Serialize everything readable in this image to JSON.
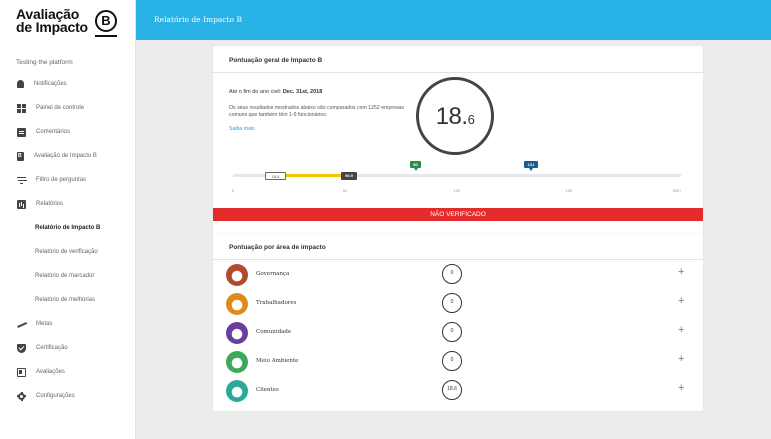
{
  "brand": {
    "line1": "Avaliação",
    "line2": "de Impacto",
    "b_mark": "B"
  },
  "sidebar": {
    "company": "Testing the platform",
    "items": [
      {
        "label": "Notificações",
        "icon": "bell-icon"
      },
      {
        "label": "Painel de controle",
        "icon": "grid-icon"
      },
      {
        "label": "Comentários",
        "icon": "comment-icon"
      },
      {
        "label": "Avaliação de Impacto B",
        "icon": "document-icon"
      },
      {
        "label": "Filtro de perguntas",
        "icon": "filter-icon"
      },
      {
        "label": "Relatórios",
        "icon": "bar-chart-icon"
      },
      {
        "label": "Relatório de Impacto B",
        "sub": true,
        "active": true
      },
      {
        "label": "Relatório de verificação",
        "sub": true
      },
      {
        "label": "Relatório de marcador",
        "sub": true
      },
      {
        "label": "Relatório de melhorias",
        "sub": true
      },
      {
        "label": "Metas",
        "icon": "trend-icon"
      },
      {
        "label": "Certificação",
        "icon": "shield-icon"
      },
      {
        "label": "Avaliações",
        "icon": "dashboard-icon"
      },
      {
        "label": "Configurações",
        "icon": "gear-icon"
      }
    ]
  },
  "topbar": {
    "title": "Relatório de Impacto B",
    "color": "#28b2e6"
  },
  "overall": {
    "title": "Pontuação geral de Impacto B",
    "date_prefix": "Até o fim do ano civil:",
    "date": "Dec. 31st, 2018",
    "compare_text": "Os seus resultados mostrados abaixo são comparados com 1252 empresas comuns que também têm 1-9 funcionários.",
    "learn_more": "Saiba mais",
    "score_int": "18.",
    "score_dec": "6",
    "score_value": 18.6,
    "scale": {
      "ticks": [
        "0",
        "50",
        "100",
        "150",
        "200+"
      ],
      "your_score_label": "18.6",
      "median_label": "50.9",
      "certification_label": "80",
      "top_label": "121"
    },
    "status": "NÃO VERIFICADO",
    "status_color": "#e42b2b"
  },
  "impact": {
    "title": "Pontuação por área de impacto",
    "areas": [
      {
        "label": "Governança",
        "score": "0",
        "icon": "governance-icon",
        "color": "#b24a2e"
      },
      {
        "label": "Trabalhadores",
        "score": "0",
        "icon": "workers-icon",
        "color": "#e08a1e"
      },
      {
        "label": "Comunidade",
        "score": "0",
        "icon": "community-icon",
        "color": "#6a3ea1"
      },
      {
        "label": "Meio Ambiente",
        "score": "0",
        "icon": "environment-icon",
        "color": "#3da85a"
      },
      {
        "label": "Clientes",
        "score": "18.6",
        "icon": "customers-icon",
        "color": "#2aa89a"
      }
    ],
    "expand_symbol": "+"
  }
}
